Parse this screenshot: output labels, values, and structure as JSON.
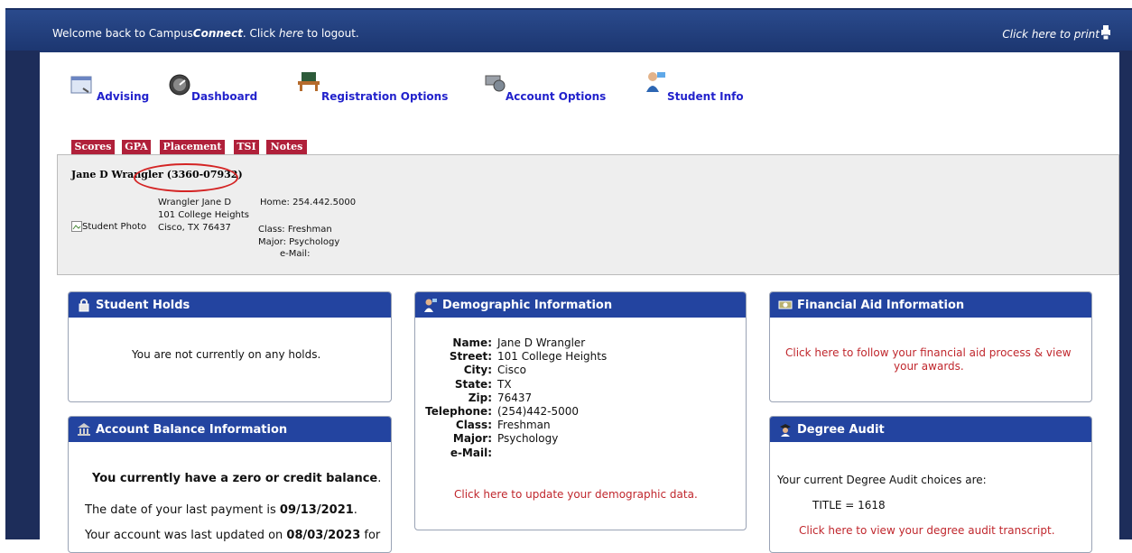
{
  "header": {
    "welcome_prefix": "Welcome back to Campus",
    "welcome_brand": "Connect",
    "welcome_mid": ". Click ",
    "welcome_link": "here",
    "welcome_suffix": " to logout.",
    "print_label": "Click here to print"
  },
  "nav": [
    {
      "label": "Advising",
      "icon": "advising-icon"
    },
    {
      "label": "Dashboard",
      "icon": "dashboard-icon"
    },
    {
      "label": "Registration Options",
      "icon": "registration-icon"
    },
    {
      "label": "Account Options",
      "icon": "account-icon"
    },
    {
      "label": "Student Info",
      "icon": "student-info-icon"
    }
  ],
  "tabs": [
    "Scores",
    "GPA",
    "Placement",
    "TSI",
    "Notes"
  ],
  "profile": {
    "name_line": "Jane D Wrangler (3360-07932)",
    "photo_alt": "Student Photo",
    "address_1": "Wrangler Jane D",
    "address_2": "101 College Heights",
    "address_3": "Cisco, TX  76437",
    "home": "Home: 254.442.5000",
    "class": "Class: Freshman",
    "major": "Major: Psychology",
    "email": "e-Mail:"
  },
  "holds": {
    "title": "Student Holds",
    "text": "You are not currently on any holds."
  },
  "demographic": {
    "title": "Demographic Information",
    "fields": [
      {
        "k": "Name:",
        "v": "Jane D Wrangler"
      },
      {
        "k": "Street:",
        "v": "101 College Heights"
      },
      {
        "k": "City:",
        "v": "Cisco"
      },
      {
        "k": "State:",
        "v": "TX"
      },
      {
        "k": "Zip:",
        "v": "76437"
      },
      {
        "k": "Telephone:",
        "v": "(254)442-5000"
      },
      {
        "k": "Class:",
        "v": "Freshman"
      },
      {
        "k": "Major:",
        "v": "Psychology"
      },
      {
        "k": "e-Mail:",
        "v": ""
      }
    ],
    "update_link": "Click here to update your demographic data."
  },
  "finaid": {
    "title": "Financial Aid Information",
    "link_1": "Click here to follow your financial aid process & view",
    "link_2": "your awards."
  },
  "account": {
    "title": "Account Balance Information",
    "balance_text": "You currently have a zero or credit balance",
    "balance_end": ".",
    "payment_prefix": "The date of your last payment is ",
    "payment_date": "09/13/2021",
    "payment_end": ".",
    "updated_prefix": "Your account was last updated on ",
    "updated_date": "08/03/2023",
    "updated_suffix": " for"
  },
  "degree": {
    "title": "Degree Audit",
    "choices": "Your current Degree Audit choices are:",
    "title_value": "TITLE = 1618",
    "transcript_link": "Click here to view your degree audit transcript."
  },
  "colors": {
    "header_blue": "#2a4a8c",
    "panel_blue": "#2344a0",
    "tab_red": "#b0203a",
    "link_red": "#c0272d",
    "nav_link": "#2222cc",
    "annotation_red": "#d42424"
  }
}
